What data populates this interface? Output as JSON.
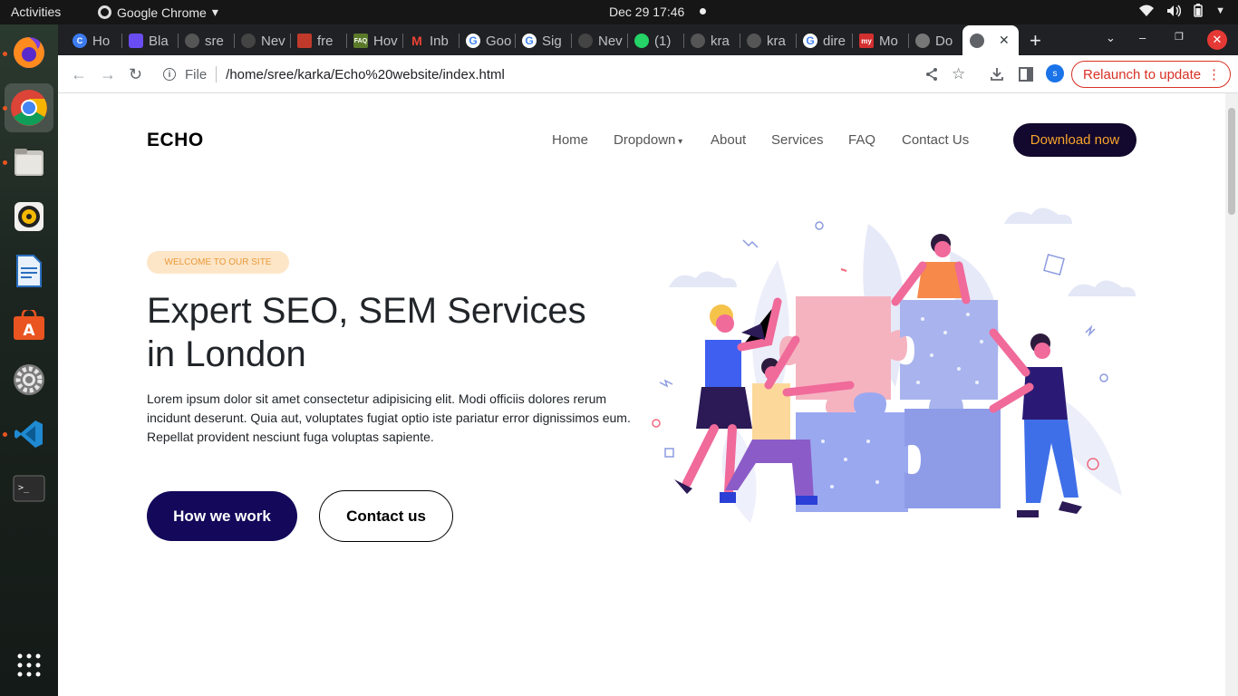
{
  "topbar": {
    "activities": "Activities",
    "app_name": "Google Chrome",
    "clock": "Dec 29  17:46"
  },
  "tabs": [
    {
      "label": "Ho",
      "fav_color": "#3d7cf0"
    },
    {
      "label": "Bla",
      "fav_color": "#6a4df2"
    },
    {
      "label": "sre",
      "fav_color": "#555"
    },
    {
      "label": "Nev",
      "fav_color": "#444"
    },
    {
      "label": "fre",
      "fav_color": "#c0392b"
    },
    {
      "label": "Hov",
      "fav_color": "#5a7a2a"
    },
    {
      "label": "Inb",
      "fav_color": "#ea4335"
    },
    {
      "label": "Goo",
      "fav_color": "#4285f4"
    },
    {
      "label": "Sig",
      "fav_color": "#4285f4"
    },
    {
      "label": "Nev",
      "fav_color": "#444"
    },
    {
      "label": "(1)",
      "fav_color": "#25d366"
    },
    {
      "label": "kra",
      "fav_color": "#555"
    },
    {
      "label": "kra",
      "fav_color": "#555"
    },
    {
      "label": "dire",
      "fav_color": "#4285f4"
    },
    {
      "label": "Mo",
      "fav_color": "#d32f2f"
    },
    {
      "label": "Do",
      "fav_color": "#777"
    }
  ],
  "toolbar": {
    "file_label": "File",
    "url": "/home/sree/karka/Echo%20website/index.html",
    "profile_initial": "s",
    "relaunch": "Relaunch to update"
  },
  "site": {
    "brand": "ECHO",
    "nav": [
      "Home",
      "Dropdown",
      "About",
      "Services",
      "FAQ",
      "Contact Us"
    ],
    "download": "Download now",
    "badge": "WELCOME TO OUR SITE",
    "headline": "Expert SEO, SEM Services in London",
    "lead": "Lorem ipsum dolor sit amet consectetur adipisicing elit. Modi officiis dolores rerum incidunt deserunt. Quia aut, voluptates fugiat optio iste pariatur error dignissimos eum. Repellat provident nesciunt fuga voluptas sapiente.",
    "btn_primary": "How we work",
    "btn_secondary": "Contact us"
  },
  "colors": {
    "brand_dark": "#13085a",
    "accent_orange": "#f7a52b",
    "badge_bg": "#fde6c8"
  }
}
